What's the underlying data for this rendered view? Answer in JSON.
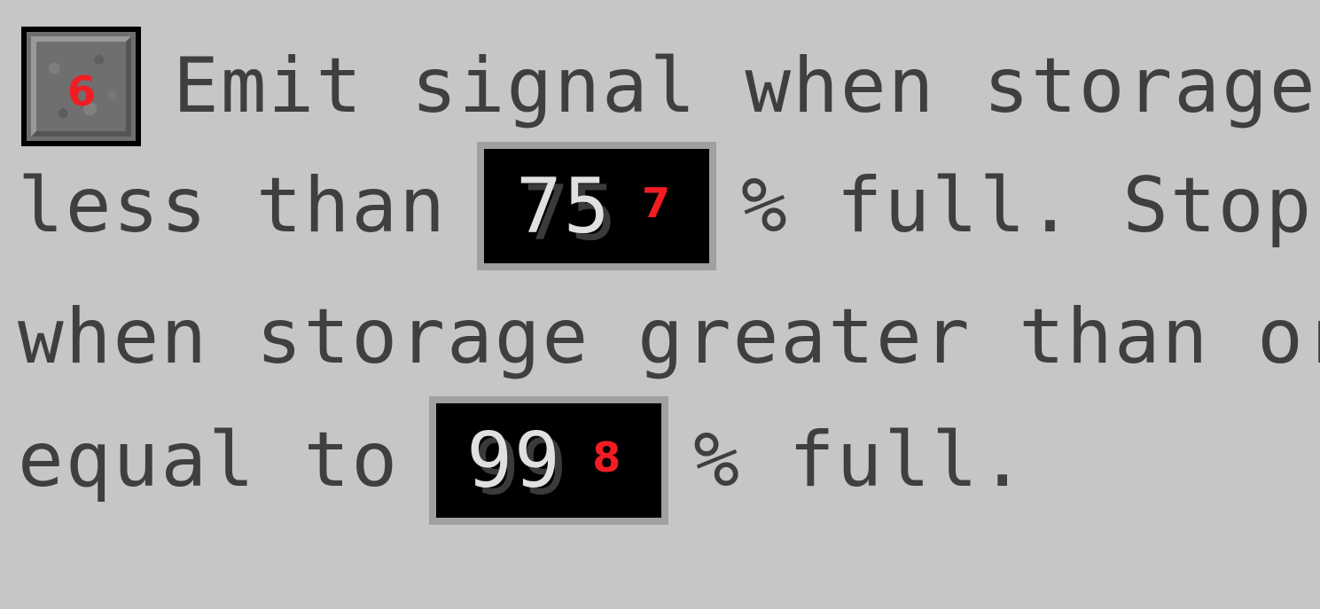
{
  "slot": {
    "marker": "6"
  },
  "line1": {
    "text": "Emit signal when storage"
  },
  "line2": {
    "before": "less than",
    "low_value": "75",
    "low_marker": "7",
    "after": "% full. Stop"
  },
  "line3": {
    "text": "when storage greater than or"
  },
  "line4": {
    "before": "equal to",
    "high_value": "99",
    "high_marker": "8",
    "after": "% full."
  },
  "colors": {
    "background": "#c6c6c6",
    "text": "#3f3f3f",
    "marker": "#f21c23",
    "input_background": "#000000",
    "input_border": "#a0a0a0",
    "input_text": "#e0e0e0"
  }
}
